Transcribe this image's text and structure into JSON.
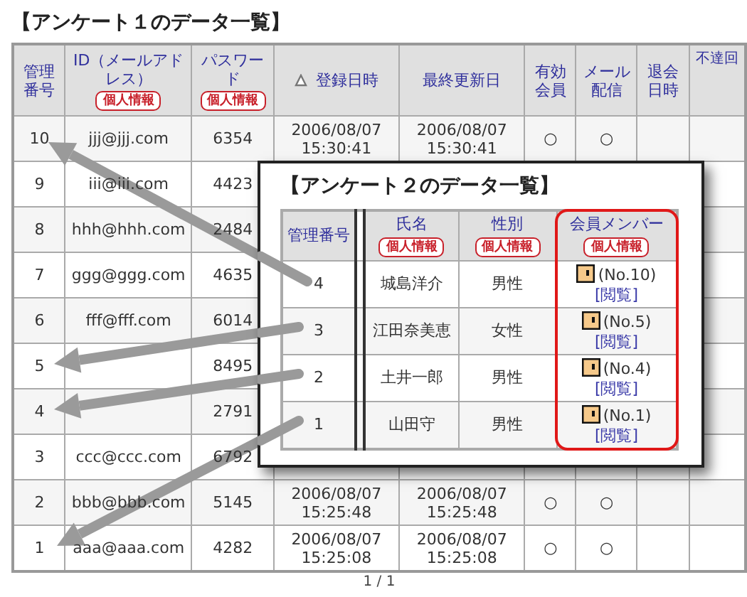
{
  "main": {
    "title": "【アンケート１のデータ一覧】",
    "columns": [
      {
        "label": "管理番号"
      },
      {
        "label": "ID（メールアドレス）",
        "badge": "個人情報"
      },
      {
        "label": "パスワード",
        "badge": "個人情報"
      },
      {
        "label": "登録日時",
        "sorted": true
      },
      {
        "label": "最終更新日"
      },
      {
        "label": "有効会員"
      },
      {
        "label": "メール配信"
      },
      {
        "label": "退会日時"
      },
      {
        "label": "不達回"
      }
    ],
    "rows": [
      {
        "cells": [
          "10",
          "jjj@jjj.com",
          "6354",
          "2006/08/07 15:30:41",
          "2006/08/07 15:30:41",
          "○",
          "○"
        ]
      },
      {
        "cells": [
          "9",
          "iii@iii.com",
          "4423"
        ]
      },
      {
        "cells": [
          "8",
          "hhh@hhh.com",
          "2484"
        ]
      },
      {
        "cells": [
          "7",
          "ggg@ggg.com",
          "4635"
        ]
      },
      {
        "cells": [
          "6",
          "fff@fff.com",
          "6014"
        ]
      },
      {
        "cells": [
          "5",
          null,
          "8495"
        ]
      },
      {
        "cells": [
          "4",
          null,
          "2791"
        ]
      },
      {
        "cells": [
          "3",
          "ccc@ccc.com",
          "6792"
        ]
      },
      {
        "cells": [
          "2",
          "bbb@bbb.com",
          "5145",
          "2006/08/07 15:25:48",
          "2006/08/07 15:25:48",
          "○",
          "○"
        ]
      },
      {
        "cells": [
          "1",
          "aaa@aaa.com",
          "4282",
          "2006/08/07 15:25:08",
          "2006/08/07 15:25:08",
          "○",
          "○"
        ]
      }
    ],
    "pagination": "1 / 1"
  },
  "popup": {
    "title": "【アンケート２のデータ一覧】",
    "columns": [
      {
        "label": "管理番号",
        "highlighted": false
      },
      {
        "label": "氏名",
        "badge": "個人情報",
        "highlighted": false
      },
      {
        "label": "性別",
        "badge": "個人情報",
        "highlighted": false
      },
      {
        "label": "会員メンバー",
        "badge": "個人情報",
        "highlighted": true
      }
    ],
    "rows": [
      {
        "no": "4",
        "name": "城島洋介",
        "gender": "男性",
        "member": "(No.10)",
        "link": "[閲覧]"
      },
      {
        "no": "3",
        "name": "江田奈美恵",
        "gender": "女性",
        "member": "(No.5)",
        "link": "[閲覧]"
      },
      {
        "no": "2",
        "name": "土井一郎",
        "gender": "男性",
        "member": "(No.4)",
        "link": "[閲覧]"
      },
      {
        "no": "1",
        "name": "山田守",
        "gender": "男性",
        "member": "(No.1)",
        "link": "[閲覧]"
      }
    ]
  }
}
